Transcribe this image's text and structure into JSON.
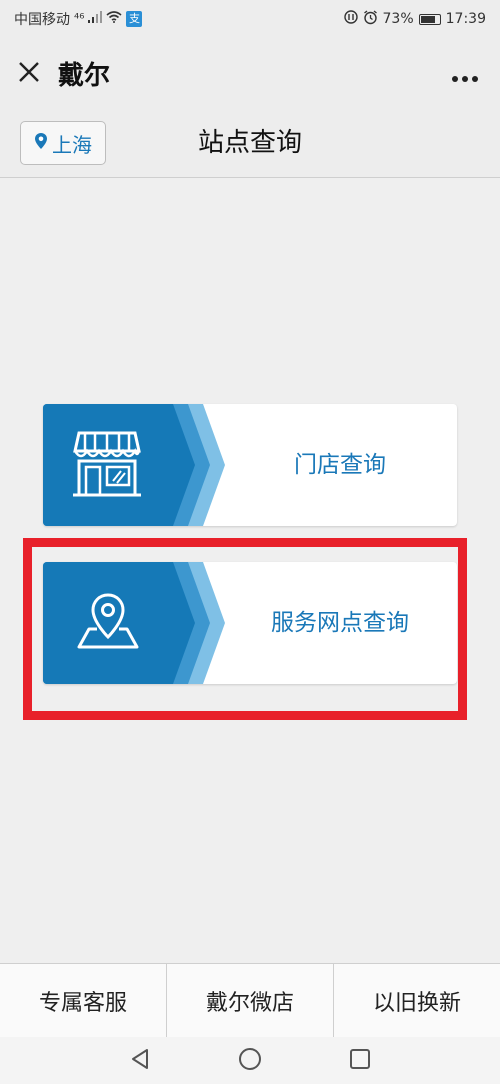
{
  "status": {
    "carrier": "中国移动",
    "network": "⁴⁶",
    "sim_badge": "支",
    "battery": "73%",
    "time": "17:39"
  },
  "titlebar": {
    "title": "戴尔",
    "close_icon": "close-icon",
    "more_icon": "more-icon"
  },
  "page": {
    "city": "上海",
    "title": "站点查询"
  },
  "cards": [
    {
      "label": "门店查询",
      "icon": "store-icon"
    },
    {
      "label": "服务网点查询",
      "icon": "map-pin-icon"
    }
  ],
  "bottom_menu": [
    "专属客服",
    "戴尔微店",
    "以旧换新"
  ],
  "colors": {
    "accent": "#1a78b8",
    "band_dark": "#1579b7",
    "band_mid": "#3d97cf",
    "band_light": "#7fc0e6",
    "highlight": "#e8202a"
  }
}
